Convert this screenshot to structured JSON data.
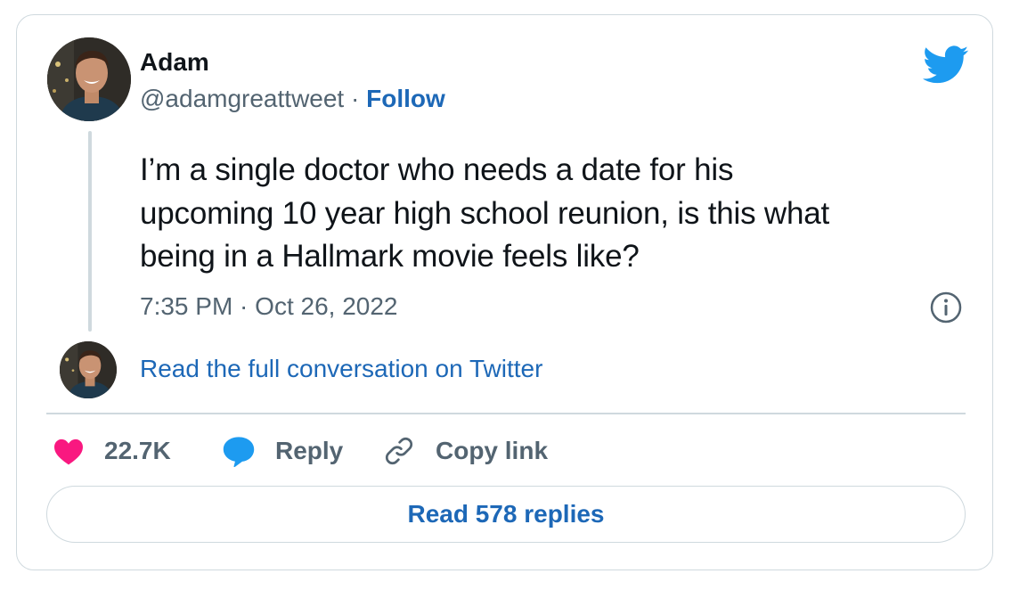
{
  "tweet": {
    "author": {
      "name": "Adam",
      "handle": "@adamgreattweet",
      "separator": "·",
      "follow_label": "Follow"
    },
    "text_lines": [
      "I’m a single doctor who needs a date for his",
      "upcoming 10 year high school reunion, is this what",
      "being in a Hallmark movie feels like?"
    ],
    "timestamp": "7:35 PM · Oct 26, 2022",
    "read_conversation_label": "Read the full conversation on Twitter"
  },
  "actions": {
    "like_count": "22.7K",
    "reply_label": "Reply",
    "copy_link_label": "Copy link"
  },
  "replies_button_label": "Read 578 replies",
  "icons": {
    "brand": "twitter-bird-icon",
    "info": "info-icon",
    "like": "heart-icon",
    "reply": "speech-bubble-icon",
    "copy": "link-icon"
  },
  "colors": {
    "twitter_blue": "#1d9bf0",
    "link_blue": "#1d68b7",
    "like_pink": "#f91880",
    "muted_text": "#536471",
    "border": "#cfd9de"
  }
}
